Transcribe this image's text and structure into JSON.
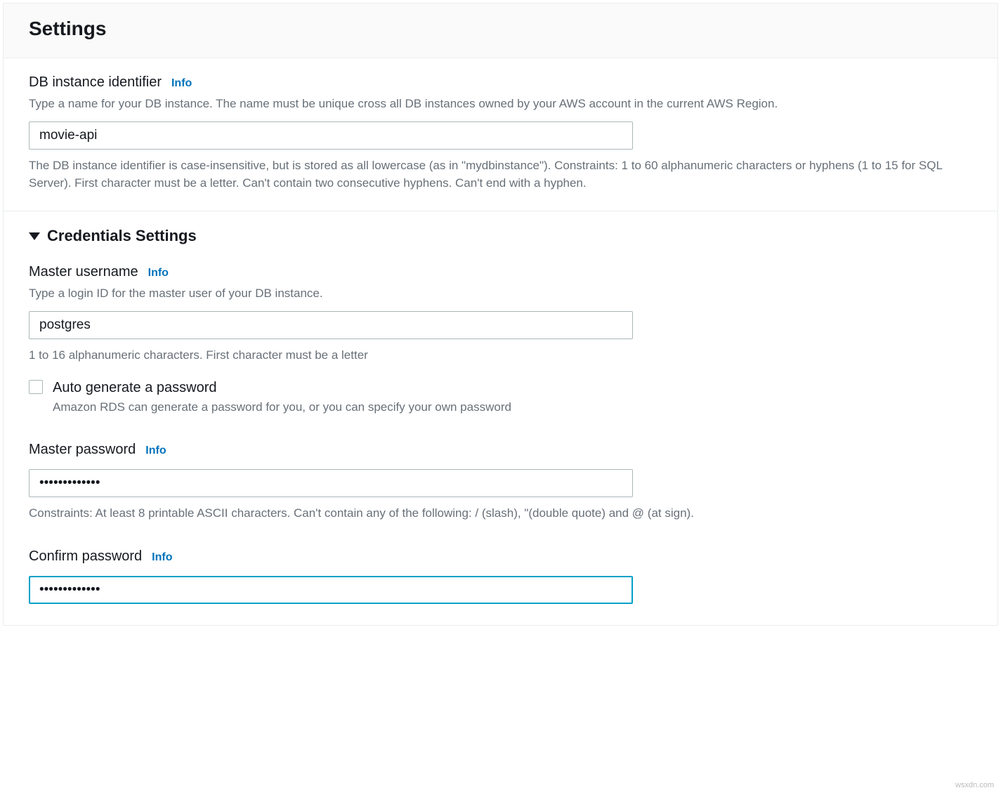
{
  "header": {
    "title": "Settings"
  },
  "info_label": "Info",
  "db_identifier": {
    "label": "DB instance identifier",
    "description": "Type a name for your DB instance. The name must be unique cross all DB instances owned by your AWS account in the current AWS Region.",
    "value": "movie-api",
    "constraint": "The DB instance identifier is case-insensitive, but is stored as all lowercase (as in \"mydbinstance\"). Constraints: 1 to 60 alphanumeric characters or hyphens (1 to 15 for SQL Server). First character must be a letter. Can't contain two consecutive hyphens. Can't end with a hyphen."
  },
  "credentials": {
    "section_title": "Credentials Settings",
    "username": {
      "label": "Master username",
      "description": "Type a login ID for the master user of your DB instance.",
      "value": "postgres",
      "constraint": "1 to 16 alphanumeric characters. First character must be a letter"
    },
    "autogen": {
      "label": "Auto generate a password",
      "description": "Amazon RDS can generate a password for you, or you can specify your own password",
      "checked": false
    },
    "password": {
      "label": "Master password",
      "value": "•••••••••••••",
      "constraint": "Constraints: At least 8 printable ASCII characters. Can't contain any of the following: / (slash), \"(double quote) and @ (at sign)."
    },
    "confirm_password": {
      "label": "Confirm password",
      "value": "•••••••••••••"
    }
  },
  "watermark": "wsxdn.com"
}
